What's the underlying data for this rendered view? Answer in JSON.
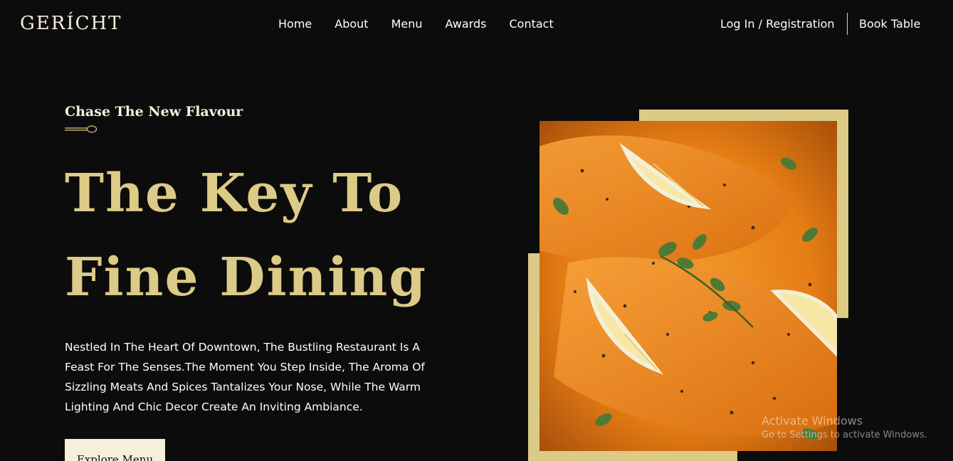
{
  "brand": {
    "logo": "GERÍCHT"
  },
  "nav": {
    "links": [
      "Home",
      "About",
      "Menu",
      "Awards",
      "Contact"
    ],
    "login": "Log In / Registration",
    "book_table": "Book Table"
  },
  "hero": {
    "subtitle": "Chase The New Flavour",
    "title_line1": "The Key To",
    "title_line2": "Fine Dining",
    "description": "Nestled In The Heart Of Downtown, The Bustling Restaurant Is A Feast For The Senses.The Moment You Step Inside, The Aroma Of Sizzling Meats And Spices Tantalizes Your Nose, While The Warm Lighting And Chic Decor Create An Inviting Ambiance.",
    "cta": "Explore Menu"
  },
  "watermark": {
    "title": "Activate Windows",
    "subtitle": "Go to Settings to activate Windows."
  },
  "colors": {
    "background": "#0c0c0c",
    "gold": "#dcca87",
    "cream": "#f5efdb",
    "white": "#ffffff"
  },
  "icons": {
    "spoon": "spoon-icon",
    "food_image": "salmon-dish-image"
  }
}
